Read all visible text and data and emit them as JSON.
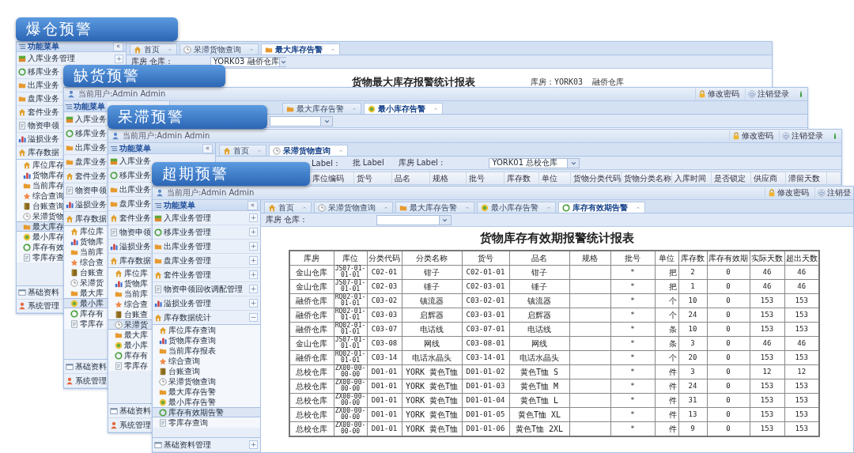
{
  "windows": [
    {
      "banner": "爆仓预警",
      "sidebar": {
        "title": "功能菜单",
        "collapse": "«",
        "items": [
          {
            "label": "入库业务管理",
            "toggle": "+"
          },
          {
            "label": "移库业务"
          },
          {
            "label": "出库业务"
          },
          {
            "label": "盘库业务"
          },
          {
            "label": "套件业务"
          },
          {
            "label": "物资申领"
          },
          {
            "label": "溢损业务"
          },
          {
            "label": "库存数据",
            "expanded": true,
            "children": [
              {
                "label": "库位库存",
                "selected": false
              },
              {
                "label": "货物库存",
                "selected": false
              },
              {
                "label": "当前库存",
                "selected": false
              },
              {
                "label": "综合查询",
                "selected": false
              },
              {
                "label": "台账查询",
                "selected": false
              },
              {
                "label": "呆滞货物",
                "selected": false
              },
              {
                "label": "最大库存",
                "selected": true
              },
              {
                "label": "最小库存",
                "selected": false
              },
              {
                "label": "库存有效",
                "selected": false
              },
              {
                "label": "零库存查",
                "selected": false
              }
            ]
          }
        ],
        "footer": [
          {
            "label": "基础资料"
          },
          {
            "label": "系统管理"
          }
        ]
      },
      "tabs": [
        {
          "label": "首页",
          "selected": false
        },
        {
          "label": "呆滞货物查询",
          "selected": false
        },
        {
          "label": "最大库存告警",
          "selected": true
        }
      ],
      "toolbar": [
        {
          "kind": "label",
          "text": "库房 仓库 :"
        },
        {
          "kind": "select",
          "value": "YORK03 融侨仓库"
        }
      ],
      "content": {
        "kind": "report",
        "title": "货物最大库存报警统计报表",
        "meta": "库房：YORK03  融侨仓库"
      }
    },
    {
      "banner": "缺货预警",
      "header": {
        "user": "当前用户:Admin Admin",
        "actions": [
          "修改密码",
          "注销登录"
        ],
        "exit": true
      },
      "sidebar": {
        "title": "功能菜单",
        "items": [
          {
            "label": "入库业务"
          },
          {
            "label": "移库业务"
          },
          {
            "label": "出库业务"
          },
          {
            "label": "盘库业务"
          },
          {
            "label": "套件业务"
          },
          {
            "label": "物资申领"
          },
          {
            "label": "溢损业务"
          },
          {
            "label": "库存数据",
            "expanded": true,
            "children": [
              {
                "label": "库位库",
                "selected": false
              },
              {
                "label": "货物库",
                "selected": false
              },
              {
                "label": "当前库",
                "selected": false
              },
              {
                "label": "综合查",
                "selected": false
              },
              {
                "label": "台账查",
                "selected": false
              },
              {
                "label": "呆滞货",
                "selected": false
              },
              {
                "label": "最大库",
                "selected": false
              },
              {
                "label": "最小库",
                "selected": true
              },
              {
                "label": "库存有",
                "selected": false
              },
              {
                "label": "零库存",
                "selected": false
              }
            ]
          }
        ],
        "footer": [
          {
            "label": "基础资料"
          },
          {
            "label": "系统管理"
          }
        ]
      },
      "tabs": [
        {
          "label": "最大库存告警",
          "selected": false
        },
        {
          "label": "最小库存告警",
          "selected": true
        }
      ],
      "toolbar": [
        {
          "kind": "select"
        }
      ]
    },
    {
      "banner": "呆滞预警",
      "header": {
        "user": "当前用户:Admin Admin",
        "actions": [
          "修改密码",
          "注销登录"
        ],
        "exit": true
      },
      "sidebar": {
        "title": "功能菜单",
        "collapse": "«",
        "items": [
          {
            "label": "入库业务"
          },
          {
            "label": "移库业务"
          },
          {
            "label": "出库业务"
          },
          {
            "label": "盘库业务"
          },
          {
            "label": "套件业务"
          },
          {
            "label": "物资申领"
          },
          {
            "label": "溢损业务"
          },
          {
            "label": "库存数据",
            "expanded": true,
            "children": [
              {
                "label": "库位库",
                "selected": false
              },
              {
                "label": "货物库",
                "selected": false
              },
              {
                "label": "当前库",
                "selected": false
              },
              {
                "label": "综合查",
                "selected": false
              },
              {
                "label": "台账查",
                "selected": false
              },
              {
                "label": "呆滞货",
                "selected": true
              },
              {
                "label": "最大库",
                "selected": false
              },
              {
                "label": "最小库",
                "selected": false
              },
              {
                "label": "库存有",
                "selected": false
              },
              {
                "label": "零库存",
                "selected": false
              }
            ]
          }
        ],
        "footer": [
          {
            "label": "基础资料"
          },
          {
            "label": "系统管理"
          }
        ]
      },
      "tabs": [
        {
          "label": "首页",
          "selected": false
        },
        {
          "label": "呆滞货物查询",
          "selected": true
        }
      ],
      "toolbar": [
        {
          "kind": "label",
          "text": "Label :"
        },
        {
          "kind": "label",
          "text": "批 Label"
        },
        {
          "kind": "label",
          "text": "库房 Label :"
        },
        {
          "kind": "select",
          "value": "YORK01 总校仓库"
        }
      ],
      "content": {
        "kind": "grid",
        "columns": [
          "库位编码",
          "货号",
          "品名",
          "规格",
          "批号",
          "库存数",
          "单位",
          "货物分类代码",
          "货物分类名称",
          "入库时间",
          "是否锁定",
          "供应商",
          "滞留天数"
        ]
      }
    },
    {
      "banner": "超期预警",
      "header": {
        "user": "当前用户:Admin Admin",
        "actions": [
          "修改密码",
          "注销登"
        ]
      },
      "sidebar": {
        "title": "功能菜单",
        "collapse": "«",
        "items": [
          {
            "label": "入库业务管理",
            "toggle": "+"
          },
          {
            "label": "移库业务管理",
            "toggle": "+"
          },
          {
            "label": "出库业务管理",
            "toggle": "+"
          },
          {
            "label": "盘库业务管理",
            "toggle": "+"
          },
          {
            "label": "套件业务管理",
            "toggle": "+"
          },
          {
            "label": "物资申领回收调配管理",
            "toggle": "+"
          },
          {
            "label": "溢损业务管理",
            "toggle": "+"
          },
          {
            "label": "库存数据统计",
            "toggle": "−",
            "expanded": true,
            "children": [
              {
                "label": "库位库存查询",
                "selected": false
              },
              {
                "label": "货物库存查询",
                "selected": false
              },
              {
                "label": "当前库存报表",
                "selected": false
              },
              {
                "label": "综合查询",
                "selected": false
              },
              {
                "label": "台账查询",
                "selected": false
              },
              {
                "label": "呆滞货物查询",
                "selected": false
              },
              {
                "label": "最大库存告警",
                "selected": false
              },
              {
                "label": "最小库存告警",
                "selected": false
              },
              {
                "label": "库存有效期告警",
                "selected": true
              },
              {
                "label": "零库存查询",
                "selected": false
              }
            ]
          }
        ],
        "footer": [
          {
            "label": "基础资料管理",
            "toggle": "+"
          }
        ]
      },
      "tabs": [
        {
          "label": "首页",
          "selected": false
        },
        {
          "label": "呆滞货物查询",
          "selected": false
        },
        {
          "label": "最大库存告警",
          "selected": false
        },
        {
          "label": "最小库存告警",
          "selected": false
        },
        {
          "label": "库存有效期告警",
          "selected": true
        }
      ],
      "toolbar": [
        {
          "kind": "label",
          "text": "库房 仓库 :"
        },
        {
          "kind": "select"
        }
      ],
      "content": {
        "kind": "report",
        "title": "货物库存有效期报警统计报表",
        "table": {
          "columns": [
            "库房",
            "库位",
            "分类代码",
            "分类名称",
            "货号",
            "品名",
            "规格",
            "批号",
            "单位",
            "库存数",
            "库存有效期",
            "实际天数",
            "超出天数"
          ],
          "rows": [
            [
              "金山仓库",
              "JS07-01-01-01",
              "C02-01",
              "钳子",
              "C02-01-01",
              "钳子",
              "",
              "*",
              "把",
              "2",
              "0",
              "46",
              "46"
            ],
            [
              "金山仓库",
              "JS07-01-01-01",
              "C02-03",
              "锤子",
              "C02-03-01",
              "锤子",
              "",
              "*",
              "把",
              "1",
              "0",
              "46",
              "46"
            ],
            [
              "融侨仓库",
              "RQ02-01-01-01",
              "C03-02",
              "镇流器",
              "C03-02-01",
              "镇流器",
              "",
              "*",
              "个",
              "10",
              "0",
              "153",
              "153"
            ],
            [
              "融侨仓库",
              "RQ02-01-01-01",
              "C03-03",
              "启辉器",
              "C03-03-01",
              "启辉器",
              "",
              "*",
              "个",
              "24",
              "0",
              "153",
              "153"
            ],
            [
              "融侨仓库",
              "RQ02-01-01-01",
              "C03-07",
              "电话线",
              "C03-07-01",
              "电话线",
              "",
              "*",
              "条",
              "10",
              "0",
              "153",
              "153"
            ],
            [
              "金山仓库",
              "JS07-01-01-01",
              "C03-08",
              "网线",
              "C03-08-01",
              "网线",
              "",
              "*",
              "条",
              "3",
              "0",
              "46",
              "46"
            ],
            [
              "融侨仓库",
              "RQ02-01-01-01",
              "C03-14",
              "电话水晶头",
              "C03-14-01",
              "电话水晶头",
              "",
              "*",
              "个",
              "20",
              "0",
              "153",
              "153"
            ],
            [
              "总校仓库",
              "ZX00-00-00-00",
              "D01-01",
              "YORK 黄色T恤",
              "D01-01-02",
              "黄色T恤 S",
              "",
              "*",
              "件",
              "3",
              "0",
              "12",
              "12"
            ],
            [
              "总校仓库",
              "ZX00-00-00-00",
              "D01-01",
              "YORK 黄色T恤",
              "D01-01-03",
              "黄色T恤 M",
              "",
              "*",
              "件",
              "24",
              "0",
              "153",
              "153"
            ],
            [
              "总校仓库",
              "ZX00-00-00-00",
              "D01-01",
              "YORK 黄色T恤",
              "D01-01-04",
              "黄色T恤 L",
              "",
              "*",
              "件",
              "31",
              "0",
              "153",
              "153"
            ],
            [
              "总校仓库",
              "ZX00-00-00-00",
              "D01-01",
              "YORK 黄色T恤",
              "D01-01-05",
              "黄色T恤 XL",
              "",
              "*",
              "件",
              "13",
              "0",
              "153",
              "153"
            ],
            [
              "总校仓库",
              "ZX00-00-00-00",
              "D01-01",
              "YORK 黄色T恤",
              "D01-01-06",
              "黄色T恤 2XL",
              "",
              "*",
              "件",
              "9",
              "0",
              "153",
              "153"
            ]
          ]
        }
      }
    }
  ]
}
